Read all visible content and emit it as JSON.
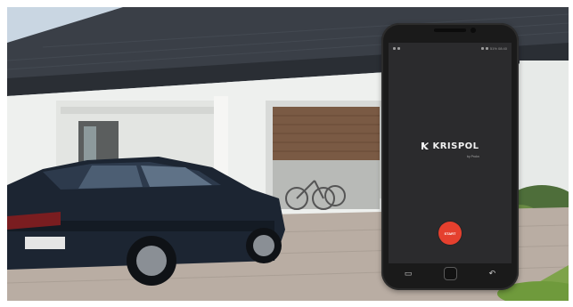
{
  "app": {
    "brand_name": "KRISPOL",
    "brand_subtitle": "by Prokn",
    "start_label": "START"
  },
  "status_bar": {
    "right_text": "51% 08:40"
  },
  "icons": [
    "krispol-logo-icon",
    "back-icon",
    "recents-icon",
    "home-button"
  ],
  "colors": {
    "screen_bg": "#2b2b2d",
    "start_button": "#e5402e",
    "brand_text": "#f2f2f2"
  }
}
